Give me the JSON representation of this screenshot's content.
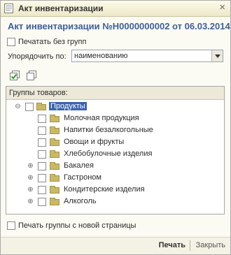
{
  "window": {
    "title": "Акт инвентаризации",
    "close_glyph": "×"
  },
  "document": {
    "header": "Акт инвентаризации №Н0000000002 от 06.03.2014"
  },
  "options": {
    "print_without_groups": "Печатать без групп",
    "sort_label": "Упорядочить по:",
    "sort_value": "наименованию",
    "print_groups_new_page": "Печать группы с новой страницы"
  },
  "toolbar": {
    "check_all_icon": "check-all-icon",
    "uncheck_all_icon": "uncheck-all-icon"
  },
  "groups": {
    "header": "Группы товаров:",
    "root": {
      "name": "Продукты",
      "expander": "⊖"
    },
    "children": [
      {
        "name": "Молочная продукция",
        "expander": ""
      },
      {
        "name": "Напитки безалкогольные",
        "expander": ""
      },
      {
        "name": "Овощи и фрукты",
        "expander": ""
      },
      {
        "name": "Хлебобулочные изделия",
        "expander": ""
      },
      {
        "name": "Бакалея",
        "expander": "⊕"
      },
      {
        "name": "Гастроном",
        "expander": "⊕"
      },
      {
        "name": "Кондитерские изделия",
        "expander": "⊕"
      },
      {
        "name": "Алкоголь",
        "expander": "⊕"
      }
    ]
  },
  "buttons": {
    "print": "Печать",
    "close": "Закрыть"
  },
  "colors": {
    "header_text": "#3d5f9a",
    "selection": "#3d63ad",
    "folder": "#c9b967"
  }
}
